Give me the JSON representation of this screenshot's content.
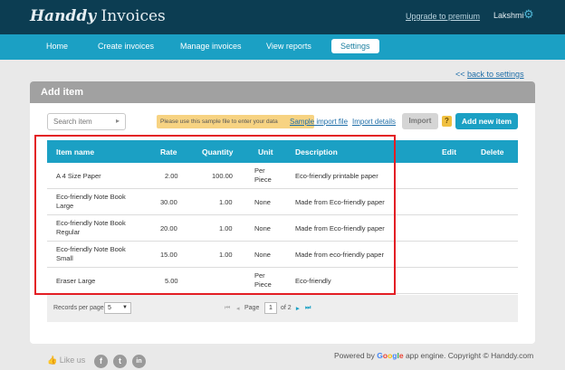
{
  "app": {
    "logo_brand": "Handdy",
    "logo_rest": " Invoices",
    "upgrade_link": "Upgrade to premium",
    "username": "Lakshmi"
  },
  "nav": {
    "items": [
      "Home",
      "Create invoices",
      "Manage invoices",
      "View reports",
      "Settings"
    ],
    "active": "Settings"
  },
  "back_link": {
    "arrow": "<<",
    "label": "back to settings"
  },
  "panel": {
    "title": "Add item",
    "search_placeholder": "Search item",
    "hint": "Please use this sample file to enter your data",
    "sample_link": "Sample import file",
    "import_details_link": "Import details",
    "import_button": "Import",
    "help": "?",
    "add_button": "Add new item"
  },
  "table": {
    "headers": [
      "Item name",
      "Rate",
      "Quantity",
      "Unit",
      "Description",
      "Edit",
      "Delete"
    ],
    "rows": [
      {
        "name1": "A 4 Size Paper",
        "name2": "",
        "rate": "2.00",
        "qty": "100.00",
        "unit1": "Per",
        "unit2": "Piece",
        "desc": "Eco-friendly printable paper"
      },
      {
        "name1": "Eco-friendly Note Book",
        "name2": "Large",
        "rate": "30.00",
        "qty": "1.00",
        "unit1": "None",
        "unit2": "",
        "desc": "Made from Eco-friendly paper"
      },
      {
        "name1": "Eco-friendly Note Book",
        "name2": "Regular",
        "rate": "20.00",
        "qty": "1.00",
        "unit1": "None",
        "unit2": "",
        "desc": "Made from Eco-friendly paper"
      },
      {
        "name1": "Eco-friendly Note Book",
        "name2": "Small",
        "rate": "15.00",
        "qty": "1.00",
        "unit1": "None",
        "unit2": "",
        "desc": "Made from eco-friendly paper"
      },
      {
        "name1": "Eraser Large",
        "name2": "",
        "rate": "5.00",
        "qty": "",
        "unit1": "Per",
        "unit2": "Piece",
        "desc": "Eco-friendly"
      }
    ],
    "records_label": "Records per page",
    "records_value": "5",
    "page_label": "Page",
    "page_value": "1",
    "page_of": "of 2"
  },
  "footer": {
    "like": "Like us",
    "social": [
      "f",
      "t",
      "in"
    ],
    "powered_pre": "Powered by ",
    "powered_post": " app engine. Copyright © Handdy.com"
  },
  "colors": {
    "topbar": "#0c3d52",
    "accent": "#1ba0c4",
    "highlight_box": "#e31e24"
  }
}
